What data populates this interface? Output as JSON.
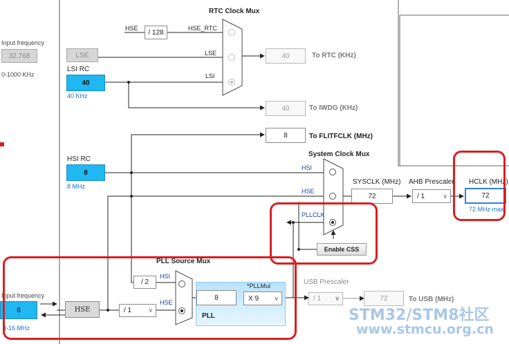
{
  "rtc_mux": {
    "title": "RTC Clock Mux",
    "hse_in": "HSE",
    "div128": "/ 128",
    "hse_rtc": "HSE_RTC",
    "lse_in": "LSE",
    "lsi_in": "LSI",
    "rtc_value": "40",
    "rtc_label": "To RTC (KHz)"
  },
  "lse_source": {
    "input_label": "Input frequency",
    "input_value": "32.768",
    "range": "0-1000 KHz",
    "name": "LSE"
  },
  "lsi_rc": {
    "label": "LSI RC",
    "value": "40",
    "freq": "40 KHz"
  },
  "iwdg": {
    "value": "40",
    "label": "To IWDG (KHz)"
  },
  "flitf": {
    "value": "8",
    "label": "To FLITFCLK (MHz)"
  },
  "hsi_rc": {
    "label": "HSI RC",
    "value": "8",
    "freq": "8 MHz"
  },
  "system_mux": {
    "title": "System Clock Mux",
    "hsi": "HSI",
    "hse": "HSE",
    "pllclk": "PLLCLK"
  },
  "sysclk": {
    "label": "SYSCLK (MHz)",
    "value": "72"
  },
  "ahb": {
    "label": "AHB Prescaler",
    "value": "/ 1"
  },
  "hclk": {
    "label": "HCLK (MHz)",
    "value": "72",
    "max": "72 MHz max"
  },
  "css_button": "Enable CSS",
  "pll_source_mux": {
    "title": "PLL Source Mux",
    "div2": "/ 2",
    "hsi": "HSI",
    "hse": "HSE"
  },
  "hse_source": {
    "input_label": "Input frequency",
    "input_value": "8",
    "range": "4-16 MHz",
    "name": "HSE",
    "prediv": "/ 1"
  },
  "pll": {
    "label": "PLL",
    "mul_label": "*PLLMul",
    "in_value": "8",
    "mul_value": "X 9"
  },
  "usb": {
    "label": "USB Prescaler",
    "value": "/ 1",
    "out_value": "72",
    "out_label": "To USB (MHz)"
  },
  "watermark": {
    "line1": "STM32/STM8社区",
    "line2": "www.stmcu.org.cn"
  },
  "colors": {
    "highlight_ring": "#d81f1f",
    "selected_source": "#1fb8f2",
    "pll_block": "#b9e3fb",
    "freq_text": "#1a6fd0"
  }
}
